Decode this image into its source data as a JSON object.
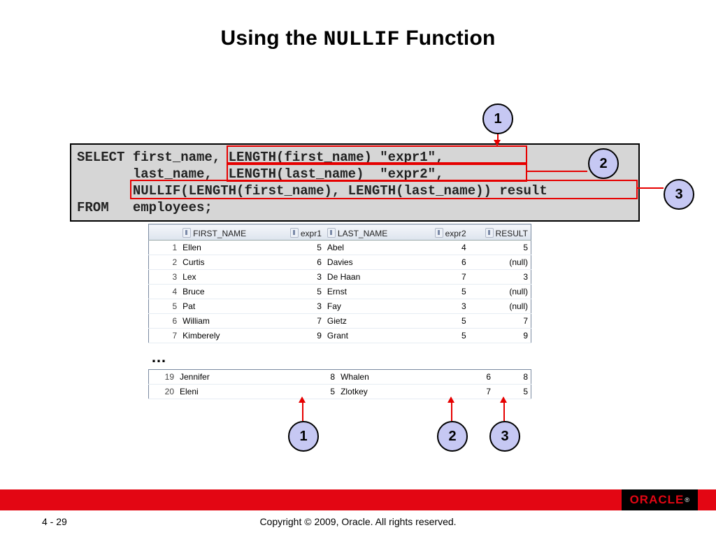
{
  "title_pre": "Using the ",
  "title_code": "NULLIF",
  "title_post": " Function",
  "sql": {
    "l1a": "SELECT first_name, ",
    "l1b": "LENGTH(first_name) \"expr1\",",
    "l2a": "       last_name,  ",
    "l2b": "LENGTH(last_name)  \"expr2\",",
    "l3a": "       ",
    "l3b": "NULLIF(LENGTH(first_name), LENGTH(last_name)) result",
    "l4": "FROM   employees;"
  },
  "callouts": {
    "one": "1",
    "two": "2",
    "three": "3"
  },
  "table": {
    "headers": {
      "first_name": "FIRST_NAME",
      "expr1": "expr1",
      "last_name": "LAST_NAME",
      "expr2": "expr2",
      "result": "RESULT"
    },
    "top_rows": [
      {
        "n": "1",
        "first": "Ellen",
        "e1": "5",
        "last": "Abel",
        "e2": "4",
        "r": "5"
      },
      {
        "n": "2",
        "first": "Curtis",
        "e1": "6",
        "last": "Davies",
        "e2": "6",
        "r": "(null)"
      },
      {
        "n": "3",
        "first": "Lex",
        "e1": "3",
        "last": "De Haan",
        "e2": "7",
        "r": "3"
      },
      {
        "n": "4",
        "first": "Bruce",
        "e1": "5",
        "last": "Ernst",
        "e2": "5",
        "r": "(null)"
      },
      {
        "n": "5",
        "first": "Pat",
        "e1": "3",
        "last": "Fay",
        "e2": "3",
        "r": "(null)"
      },
      {
        "n": "6",
        "first": "William",
        "e1": "7",
        "last": "Gietz",
        "e2": "5",
        "r": "7"
      },
      {
        "n": "7",
        "first": "Kimberely",
        "e1": "9",
        "last": "Grant",
        "e2": "5",
        "r": "9"
      }
    ],
    "bottom_rows": [
      {
        "n": "19",
        "first": "Jennifer",
        "e1": "8",
        "last": "Whalen",
        "e2": "6",
        "r": "8"
      },
      {
        "n": "20",
        "first": "Eleni",
        "e1": "5",
        "last": "Zlotkey",
        "e2": "7",
        "r": "5"
      }
    ]
  },
  "ellipsis": "…",
  "footer": {
    "page": "4 - 29",
    "copyright": "Copyright © 2009, Oracle. All rights reserved.",
    "brand": "ORACLE",
    "reg": "®"
  }
}
